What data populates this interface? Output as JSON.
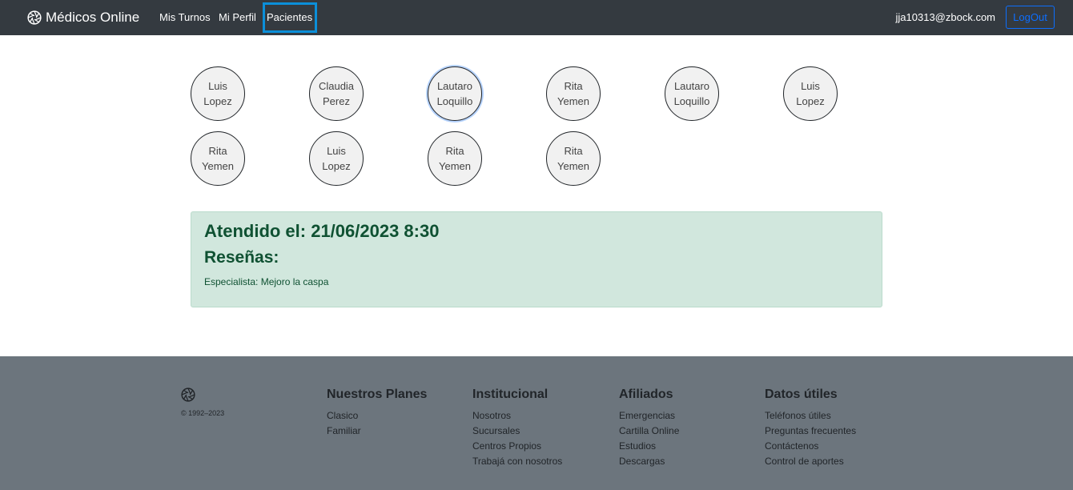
{
  "navbar": {
    "brand": "Médicos Online",
    "links": [
      "Mis Turnos",
      "Mi Perfil",
      "Pacientes"
    ],
    "active_link": "Pacientes",
    "user_email": "jja10313@zbock.com",
    "logout_label": "LogOut"
  },
  "patients": [
    {
      "first": "Luis",
      "last": "Lopez"
    },
    {
      "first": "Claudia",
      "last": "Perez"
    },
    {
      "first": "Lautaro",
      "last": "Loquillo"
    },
    {
      "first": "Rita",
      "last": "Yemen"
    },
    {
      "first": "Lautaro",
      "last": "Loquillo"
    },
    {
      "first": "Luis",
      "last": "Lopez"
    },
    {
      "first": "Rita",
      "last": "Yemen"
    },
    {
      "first": "Luis",
      "last": "Lopez"
    },
    {
      "first": "Rita",
      "last": "Yemen"
    },
    {
      "first": "Rita",
      "last": "Yemen"
    }
  ],
  "appointment": {
    "attended": "Atendido el: 21/06/2023 8:30",
    "reviews_title": "Reseñas:",
    "review_text": "Especialista: Mejoro la caspa"
  },
  "footer": {
    "copyright": "© 1992–2023",
    "columns": [
      {
        "title": "Nuestros Planes",
        "links": [
          "Clasico",
          "Familiar"
        ]
      },
      {
        "title": "Institucional",
        "links": [
          "Nosotros",
          "Sucursales",
          "Centros Propios",
          "Trabajá con nosotros"
        ]
      },
      {
        "title": "Afiliados",
        "links": [
          "Emergencias",
          "Cartilla Online",
          "Estudios",
          "Descargas"
        ]
      },
      {
        "title": "Datos útiles",
        "links": [
          "Teléfonos útiles",
          "Preguntas frecuentes",
          "Contáctenos",
          "Control de aportes"
        ]
      }
    ]
  },
  "colors": {
    "navbar_bg": "#343a40",
    "footer_bg": "#6c757d",
    "alert_bg": "#d1e7dd",
    "alert_text": "#0f5132",
    "accent": "#0d6efd"
  },
  "icons": {
    "brand": "aperture-icon",
    "footer_logo": "aperture-icon"
  }
}
